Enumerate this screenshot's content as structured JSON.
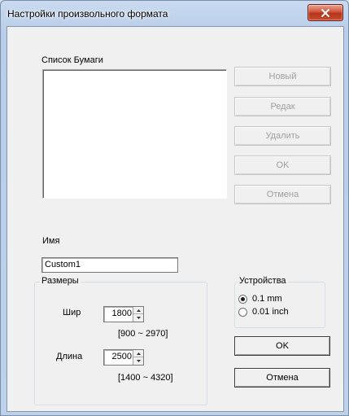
{
  "window": {
    "title": "Настройки произвольного формата"
  },
  "paper_list": {
    "label": "Список Бумаги"
  },
  "side_buttons": {
    "new": "Новый",
    "edit": "Редак",
    "delete": "Удалить",
    "ok": "OK",
    "cancel": "Отмена"
  },
  "name": {
    "label": "Имя",
    "value": "Custom1"
  },
  "size_group": {
    "title": "Размеры",
    "width_label": "Шир",
    "width_value": "1800",
    "width_range": "[900 ~ 2970]",
    "length_label": "Длина",
    "length_value": "2500",
    "length_range": "[1400 ~ 4320]"
  },
  "units_group": {
    "title": "Устройства",
    "option_1": "0.1 mm",
    "option_2": "0.01 inch",
    "selected": "0.1 mm"
  },
  "bottom_buttons": {
    "ok": "OK",
    "cancel": "Отмена"
  }
}
